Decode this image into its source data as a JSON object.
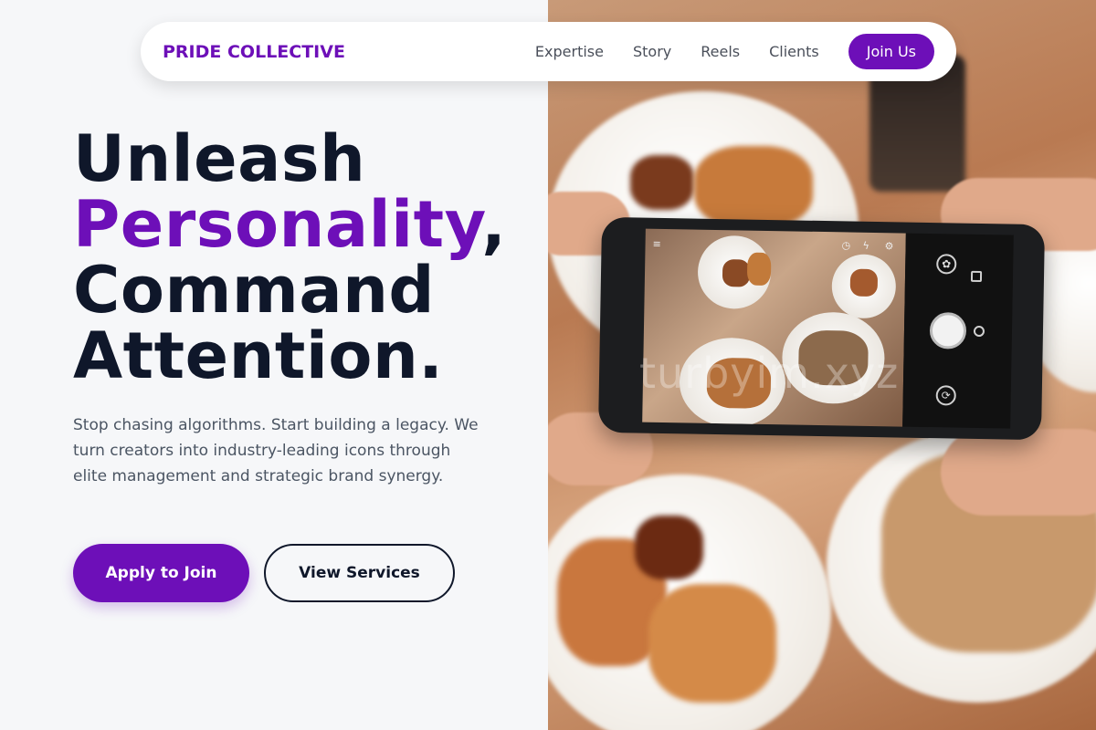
{
  "brand": {
    "name": "PRIDE COLLECTIVE"
  },
  "nav": {
    "links": [
      "Expertise",
      "Story",
      "Reels",
      "Clients"
    ],
    "cta": "Join Us"
  },
  "hero": {
    "title_line1": "Unleash",
    "title_accent": "Personality",
    "title_comma": ",",
    "title_line3": "Command",
    "title_line4": "Attention.",
    "subtitle": "Stop chasing algorithms. Start building a legacy. We turn creators into industry-leading icons through elite management and strategic brand synergy.",
    "primary_button": "Apply to Join",
    "secondary_button": "View Services"
  },
  "image": {
    "watermark": "turbyim.xyz",
    "description_icons": [
      "camera-shutter-icon",
      "switch-camera-icon",
      "lens-filter-icon"
    ]
  },
  "colors": {
    "accent": "#6d0fb8",
    "heading": "#0f172a",
    "body_text": "#4b5563",
    "page_bg": "#f6f7f9"
  }
}
